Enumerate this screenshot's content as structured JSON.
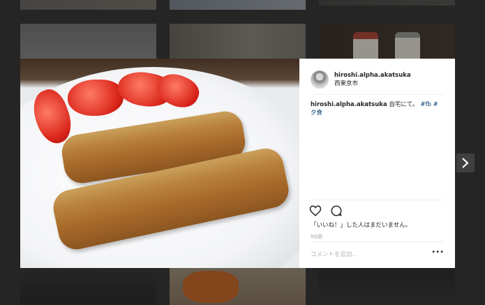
{
  "post": {
    "username": "hiroshi.alpha.akatsuka",
    "location": "西東京市",
    "caption": {
      "user": "hiroshi.alpha.akatsuka",
      "text": " 自宅にて。 ",
      "tag1": "#fb",
      "tag2": "#夕食"
    },
    "likes_text": "「いいね！」した人はまだいません。",
    "time": "9分前",
    "comment_placeholder": "コメントを追加...",
    "more_label": "•••"
  },
  "icons": {
    "like": "heart-icon",
    "comment": "speech-bubble-icon",
    "next": "chevron-right-icon",
    "more": "ellipsis-icon"
  },
  "colors": {
    "hashtag": "#003569",
    "text": "#262626",
    "muted": "#999999"
  }
}
